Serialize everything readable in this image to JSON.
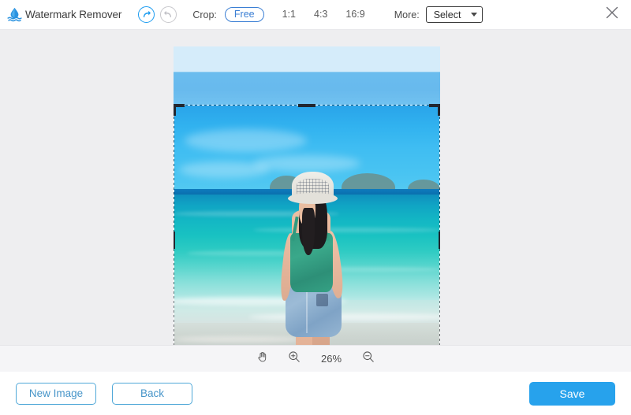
{
  "app": {
    "title": "Watermark Remover",
    "logo_icon": "water-drop-icon"
  },
  "toolbar": {
    "undo_icon": "undo-arrow-icon",
    "redo_icon": "redo-arrow-icon",
    "crop_label": "Crop:",
    "ratios": [
      {
        "label": "Free",
        "selected": true
      },
      {
        "label": "1:1",
        "selected": false
      },
      {
        "label": "4:3",
        "selected": false
      },
      {
        "label": "16:9",
        "selected": false
      }
    ],
    "more_label": "More:",
    "select_value": "Select",
    "select_caret_icon": "chevron-down-icon",
    "close_icon": "close-icon"
  },
  "canvas": {
    "image_alt": "Woman in green crop top and denim shorts standing in shallow turquoise sea with islands on the horizon",
    "crop_selection": {
      "handles": [
        "top-left-corner",
        "top-center",
        "top-right-corner",
        "left-middle",
        "right-middle"
      ]
    }
  },
  "zoombar": {
    "pan_icon": "hand-pan-icon",
    "zoom_in_icon": "zoom-in-icon",
    "zoom_level": "26%",
    "zoom_out_icon": "zoom-out-icon"
  },
  "footer": {
    "new_image_label": "New Image",
    "back_label": "Back",
    "save_label": "Save"
  },
  "colors": {
    "accent_blue": "#27a2ec",
    "pill_blue": "#3b7fd4",
    "outline_blue": "#4fa8d8",
    "canvas_bg": "#eeeef0",
    "zoombar_bg": "#f5f5f7"
  }
}
